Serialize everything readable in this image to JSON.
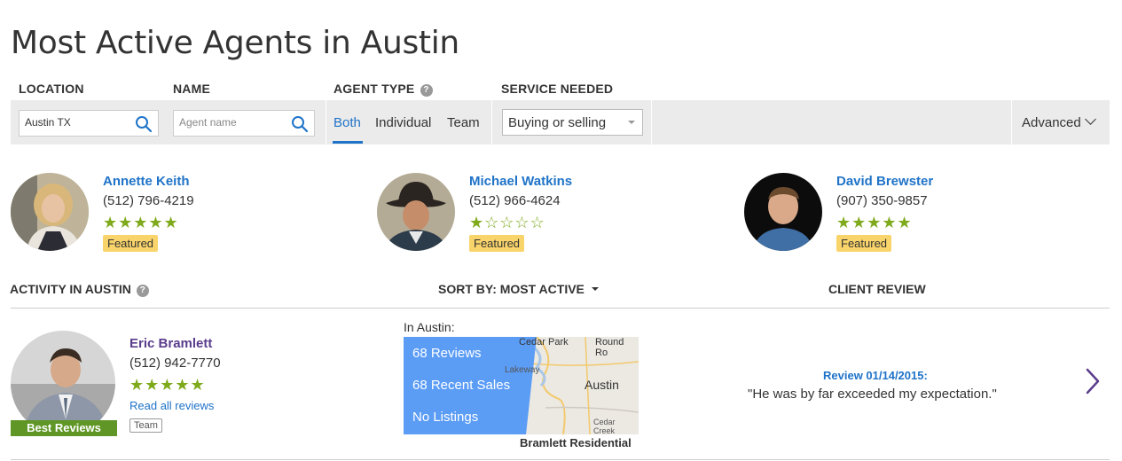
{
  "page": {
    "title": "Most Active Agents in Austin"
  },
  "filters": {
    "location_label": "LOCATION",
    "location_value": "Austin TX",
    "name_label": "NAME",
    "name_placeholder": "Agent name",
    "agent_type_label": "AGENT TYPE",
    "agent_type_help": "?",
    "agent_types": [
      "Both",
      "Individual",
      "Team"
    ],
    "agent_type_selected": "Both",
    "service_label": "SERVICE NEEDED",
    "service_value": "Buying or selling",
    "advanced_label": "Advanced"
  },
  "featured_agents": [
    {
      "name": "Annette Keith",
      "phone": "(512) 796-4219",
      "rating": 5,
      "badge": "Featured"
    },
    {
      "name": "Michael Watkins",
      "phone": "(512) 966-4624",
      "rating": 1,
      "badge": "Featured"
    },
    {
      "name": "David Brewster",
      "phone": "(907) 350-9857",
      "rating": 5,
      "badge": "Featured"
    }
  ],
  "list_header": {
    "activity": "ACTIVITY IN AUSTIN",
    "activity_help": "?",
    "sort": "SORT BY: MOST ACTIVE",
    "review": "CLIENT REVIEW"
  },
  "agent_row": {
    "name": "Eric Bramlett",
    "phone": "(512) 942-7770",
    "rating": 5,
    "read_reviews": "Read all reviews",
    "tag": "Team",
    "badge": "Best Reviews",
    "in_city": "In Austin:",
    "reviews": "68 Reviews",
    "recent_sales": "68 Recent Sales",
    "listings": "No Listings",
    "map_labels": {
      "cedar_park": "Cedar Park",
      "round_rock": "Round Ro",
      "lakeway": "Lakeway",
      "austin": "Austin",
      "cedar_creek": "Cedar Creek"
    },
    "brokerage": "Bramlett Residential",
    "review_date": "Review 01/14/2015:",
    "review_text": "\"He was by far exceeded my expectation.\""
  },
  "colors": {
    "link": "#1f73c8",
    "star": "#7eaa1b",
    "featured": "#f9d46a",
    "best_badge": "#5f9626",
    "stats_overlay": "#5b9cf5",
    "arrow": "#5a3c8c"
  },
  "icons": {
    "search": "search-icon",
    "help": "help-icon",
    "chevron": "chevron-down-icon",
    "next": "chevron-right-icon"
  }
}
